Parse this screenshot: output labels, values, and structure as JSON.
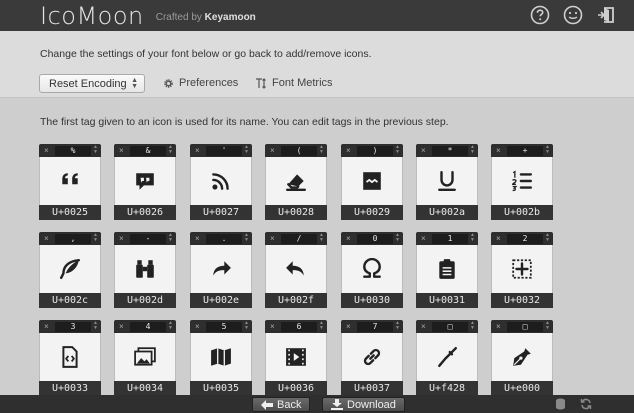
{
  "header": {
    "title": "IcoMoon",
    "crafted_prefix": "Crafted by",
    "crafted_name": "Keyamoon"
  },
  "settings": {
    "message": "Change the settings of your font below or go back to add/remove icons.",
    "encoding_select": "Reset Encoding",
    "preferences": "Preferences",
    "font_metrics": "Font Metrics"
  },
  "main": {
    "info": "The first tag given to an icon is used for its name. You can edit tags in the previous step.",
    "glyphs": [
      {
        "tag": "%",
        "code": "U+0025",
        "icon": "quote-icon"
      },
      {
        "tag": "&",
        "code": "U+0026",
        "icon": "quote-bubble-icon"
      },
      {
        "tag": "'",
        "code": "U+0027",
        "icon": "rss-icon"
      },
      {
        "tag": "(",
        "code": "U+0028",
        "icon": "eraser-icon"
      },
      {
        "tag": ")",
        "code": "U+0029",
        "icon": "image-wave-icon"
      },
      {
        "tag": "*",
        "code": "U+002a",
        "icon": "underline-icon"
      },
      {
        "tag": "+",
        "code": "U+002b",
        "icon": "numbered-list-icon"
      },
      {
        "tag": ",",
        "code": "U+002c",
        "icon": "feather-icon"
      },
      {
        "tag": "-",
        "code": "U+002d",
        "icon": "binoculars-icon"
      },
      {
        "tag": ".",
        "code": "U+002e",
        "icon": "redo-arrow-icon"
      },
      {
        "tag": "/",
        "code": "U+002f",
        "icon": "undo-arrow-icon"
      },
      {
        "tag": "0",
        "code": "U+0030",
        "icon": "omega-icon"
      },
      {
        "tag": "1",
        "code": "U+0031",
        "icon": "clipboard-list-icon"
      },
      {
        "tag": "2",
        "code": "U+0032",
        "icon": "add-box-icon"
      },
      {
        "tag": "3",
        "code": "U+0033",
        "icon": "code-file-icon"
      },
      {
        "tag": "4",
        "code": "U+0034",
        "icon": "images-icon"
      },
      {
        "tag": "5",
        "code": "U+0035",
        "icon": "map-icon"
      },
      {
        "tag": "6",
        "code": "U+0036",
        "icon": "film-play-icon"
      },
      {
        "tag": "7",
        "code": "U+0037",
        "icon": "link-icon"
      },
      {
        "tag": "□",
        "code": "U+f428",
        "icon": "pin-icon"
      },
      {
        "tag": "□",
        "code": "U+e000",
        "icon": "pen-nib-icon"
      }
    ]
  },
  "footer": {
    "back": "Back",
    "download": "Download"
  }
}
